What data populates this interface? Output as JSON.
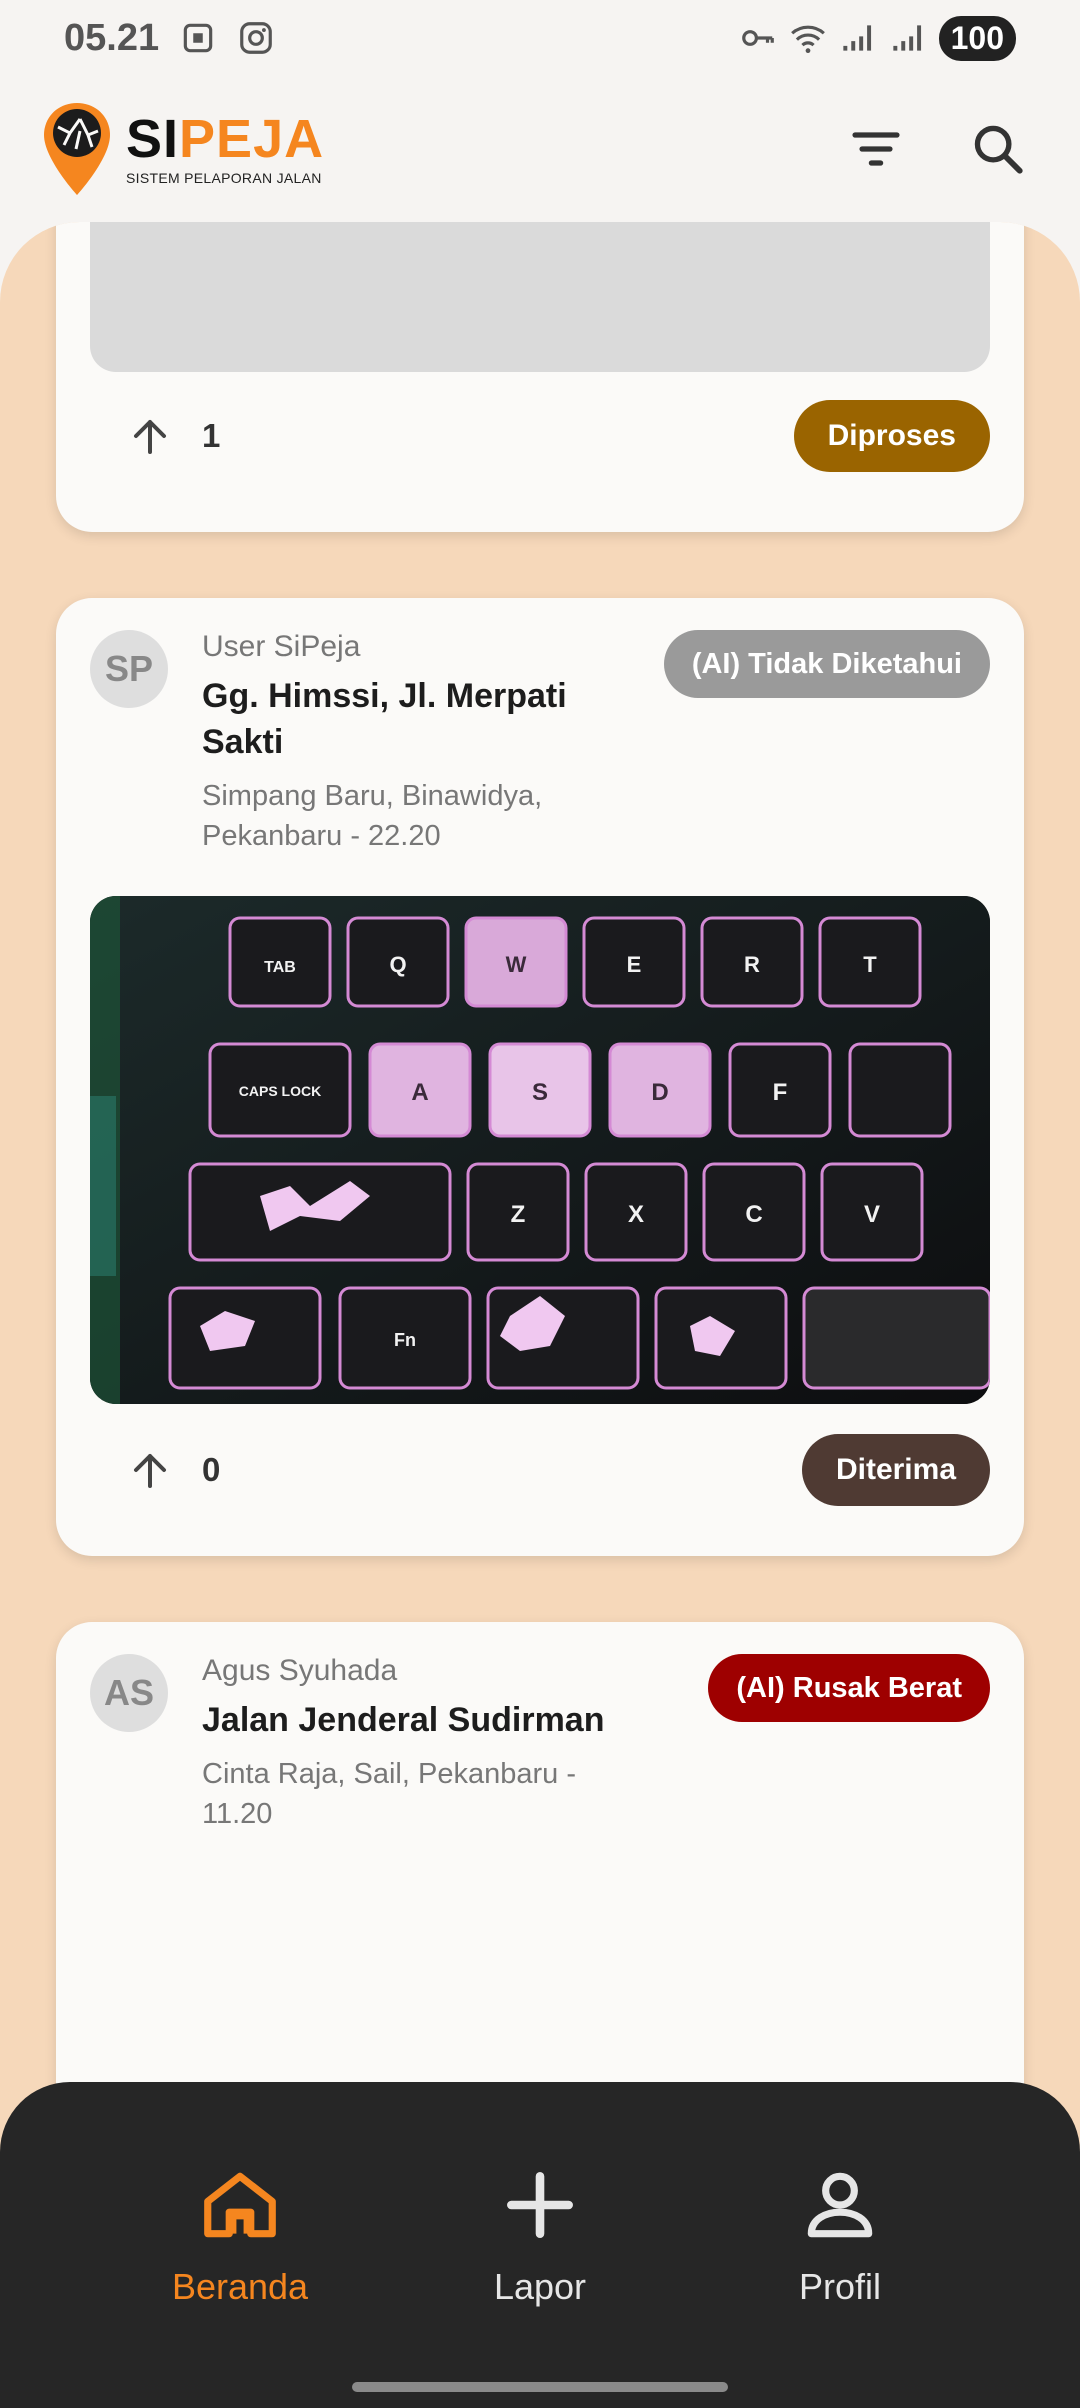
{
  "status_bar": {
    "time": "05.21",
    "battery": "100"
  },
  "brand": {
    "name_part1": "SI",
    "name_part2": "PEJA",
    "subtitle": "SISTEM PELAPORAN JALAN"
  },
  "icons": {
    "filter": "filter-icon",
    "search": "search-icon",
    "upvote": "arrow-up-icon",
    "home": "home-icon",
    "add": "plus-icon",
    "profile": "person-icon"
  },
  "colors": {
    "brand_orange": "#f5861f",
    "status_diproses": "#9a6400",
    "status_diterima": "#4f3a33",
    "ai_unknown": "#9a9a9a",
    "ai_severe": "#9e0000",
    "nav_bg": "#262626",
    "content_bg": "#f6d8ba"
  },
  "posts": [
    {
      "votes": "1",
      "status": "Diproses"
    },
    {
      "avatar": "SP",
      "user": "User SiPeja",
      "street": "Gg. Himssi, Jl. Merpati Sakti",
      "location": "Simpang Baru, Binawidya, Pekanbaru - 22.20",
      "ai_label": "(AI) Tidak Diketahui",
      "votes": "0",
      "status": "Diterima"
    },
    {
      "avatar": "AS",
      "user": "Agus Syuhada",
      "street": "Jalan Jenderal Sudirman",
      "location": "Cinta Raja, Sail, Pekanbaru - 11.20",
      "ai_label": "(AI) Rusak Berat"
    }
  ],
  "keyboard_keys": [
    "TAB",
    "Q",
    "W",
    "E",
    "R",
    "T",
    "CAPS LOCK",
    "A",
    "S",
    "D",
    "F",
    "Z",
    "X",
    "C",
    "V",
    "Fn"
  ],
  "nav": {
    "home": "Beranda",
    "report": "Lapor",
    "profile": "Profil"
  }
}
